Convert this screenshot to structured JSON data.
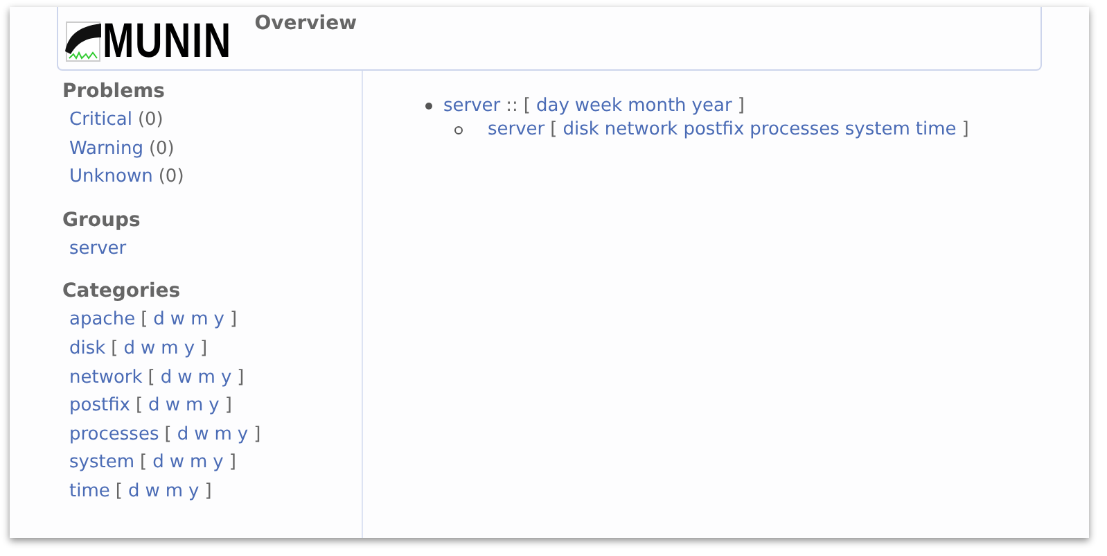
{
  "header": {
    "logo_text": "MUNIN",
    "title": "Overview"
  },
  "problems": {
    "heading": "Problems",
    "items": [
      {
        "label": "Critical",
        "count": "(0)"
      },
      {
        "label": "Warning",
        "count": "(0)"
      },
      {
        "label": "Unknown",
        "count": "(0)"
      }
    ]
  },
  "groups": {
    "heading": "Groups",
    "items": [
      "server"
    ]
  },
  "categories": {
    "heading": "Categories",
    "items": [
      {
        "name": "apache",
        "open": "[",
        "links": [
          "d",
          "w",
          "m",
          "y"
        ],
        "close": "]"
      },
      {
        "name": "disk",
        "open": "[",
        "links": [
          "d",
          "w",
          "m",
          "y"
        ],
        "close": "]"
      },
      {
        "name": "network",
        "open": "[",
        "links": [
          "d",
          "w",
          "m",
          "y"
        ],
        "close": "]"
      },
      {
        "name": "postfix",
        "open": "[",
        "links": [
          "d",
          "w",
          "m",
          "y"
        ],
        "close": "]"
      },
      {
        "name": "processes",
        "open": "[",
        "links": [
          "d",
          "w",
          "m",
          "y"
        ],
        "close": "]"
      },
      {
        "name": "system",
        "open": "[",
        "links": [
          "d",
          "w",
          "m",
          "y"
        ],
        "close": "]"
      },
      {
        "name": "time",
        "open": "[",
        "links": [
          "d",
          "w",
          "m",
          "y"
        ],
        "close": "]"
      }
    ]
  },
  "tree": [
    {
      "name": "server",
      "separator": "::",
      "open": "[",
      "links": [
        "day",
        "week",
        "month",
        "year"
      ],
      "close": "]",
      "children": [
        {
          "name": "server",
          "open": "[",
          "links": [
            "disk",
            "network",
            "postfix",
            "processes",
            "system",
            "time"
          ],
          "close": "]"
        }
      ]
    }
  ]
}
